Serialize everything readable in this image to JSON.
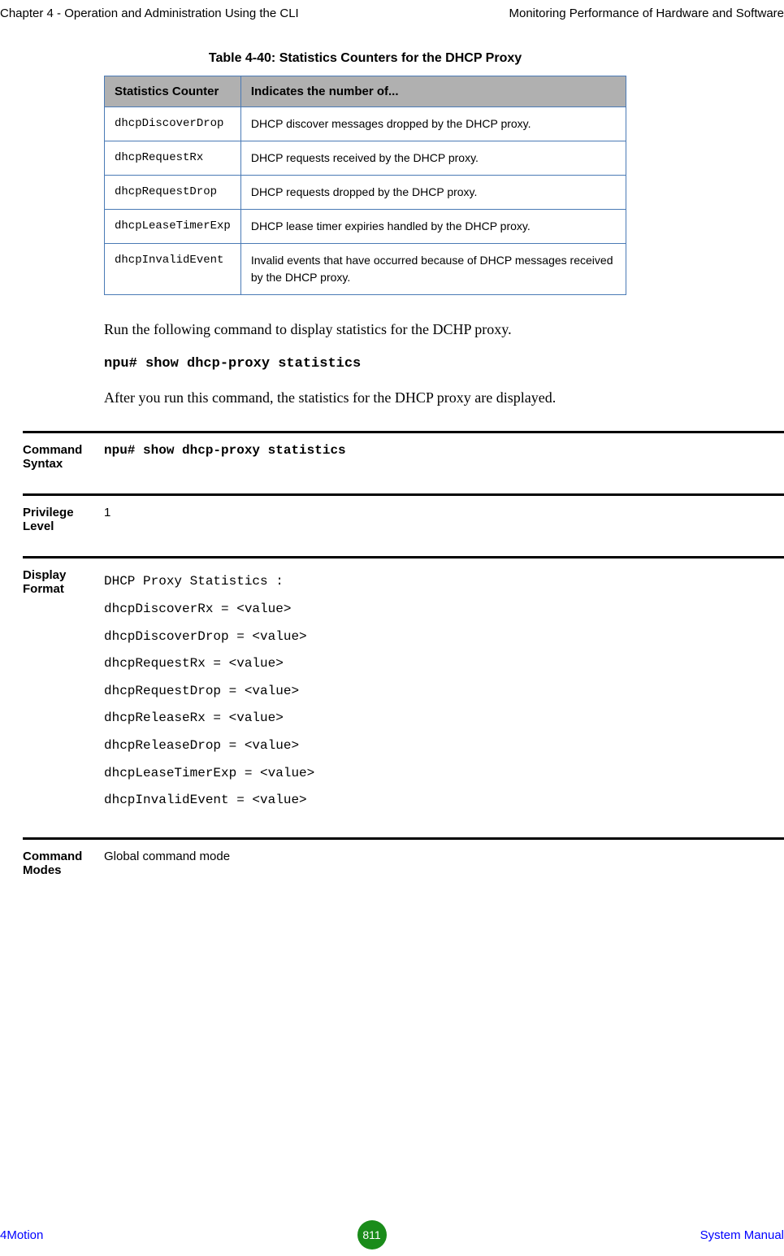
{
  "header": {
    "left": "Chapter 4 - Operation and Administration Using the CLI",
    "right": "Monitoring Performance of Hardware and Software"
  },
  "table": {
    "caption": "Table 4-40: Statistics Counters for the DHCP Proxy",
    "columns": {
      "col1": "Statistics Counter",
      "col2": "Indicates the number of..."
    },
    "rows": [
      {
        "counter": "dhcpDiscoverDrop",
        "desc": "DHCP discover messages dropped by the DHCP proxy."
      },
      {
        "counter": "dhcpRequestRx",
        "desc": "DHCP requests received by the DHCP proxy."
      },
      {
        "counter": "dhcpRequestDrop",
        "desc": "DHCP requests dropped by the DHCP proxy."
      },
      {
        "counter": "dhcpLeaseTimerExp",
        "desc": "DHCP lease timer expiries handled by the DHCP proxy."
      },
      {
        "counter": "dhcpInvalidEvent",
        "desc": "Invalid events that have occurred because of DHCP messages received by the DHCP proxy."
      }
    ]
  },
  "body": {
    "p1": "Run the following command to display statistics for the DCHP proxy.",
    "cmd": "npu# show dhcp-proxy statistics",
    "p2": "After you run this command, the statistics for the DHCP proxy are displayed."
  },
  "sections": {
    "command_syntax": {
      "label": "Command Syntax",
      "value": "npu# show dhcp-proxy statistics"
    },
    "privilege_level": {
      "label": "Privilege Level",
      "value": "1"
    },
    "display_format": {
      "label": "Display Format",
      "lines": [
        "DHCP Proxy Statistics :",
        "dhcpDiscoverRx = <value>",
        "dhcpDiscoverDrop = <value>",
        "dhcpRequestRx = <value>",
        "dhcpRequestDrop = <value>",
        "dhcpReleaseRx = <value>",
        "dhcpReleaseDrop = <value>",
        "dhcpLeaseTimerExp = <value>",
        "dhcpInvalidEvent = <value>"
      ]
    },
    "command_modes": {
      "label": "Command Modes",
      "value": "Global command mode"
    }
  },
  "footer": {
    "left": "4Motion",
    "page": "811",
    "right": "System Manual"
  }
}
